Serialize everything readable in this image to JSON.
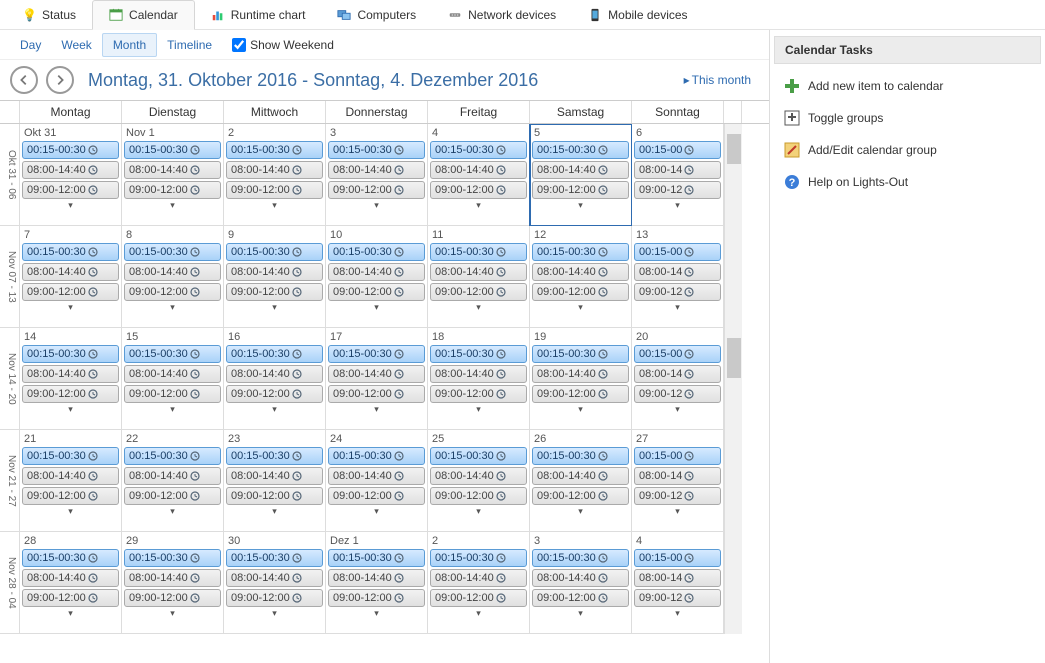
{
  "tabs": {
    "status": "Status",
    "calendar": "Calendar",
    "runtime": "Runtime chart",
    "computers": "Computers",
    "network": "Network devices",
    "mobile": "Mobile devices"
  },
  "view": {
    "day": "Day",
    "week": "Week",
    "month": "Month",
    "timeline": "Timeline",
    "show_weekend": "Show Weekend"
  },
  "header": {
    "range": "Montag, 31. Oktober 2016 - Sonntag, 4. Dezember 2016",
    "this_month": "This month"
  },
  "columns": [
    "",
    "Montag",
    "Dienstag",
    "Mittwoch",
    "Donnerstag",
    "Freitag",
    "Samstag",
    "Sonntag",
    ""
  ],
  "weeks": [
    {
      "label": "Okt 31 - 06",
      "days": [
        {
          "label": "Okt 31",
          "narrow": false,
          "sel": false
        },
        {
          "label": "Nov 1",
          "narrow": false,
          "sel": false
        },
        {
          "label": "2",
          "narrow": false,
          "sel": false
        },
        {
          "label": "3",
          "narrow": false,
          "sel": false
        },
        {
          "label": "4",
          "narrow": false,
          "sel": false
        },
        {
          "label": "5",
          "narrow": false,
          "sel": true
        },
        {
          "label": "6",
          "narrow": true,
          "sel": false
        }
      ]
    },
    {
      "label": "Nov 07 - 13",
      "days": [
        {
          "label": "7",
          "narrow": false
        },
        {
          "label": "8",
          "narrow": false
        },
        {
          "label": "9",
          "narrow": false
        },
        {
          "label": "10",
          "narrow": false
        },
        {
          "label": "11",
          "narrow": false
        },
        {
          "label": "12",
          "narrow": false
        },
        {
          "label": "13",
          "narrow": true
        }
      ]
    },
    {
      "label": "Nov 14 - 20",
      "days": [
        {
          "label": "14",
          "narrow": false
        },
        {
          "label": "15",
          "narrow": false
        },
        {
          "label": "16",
          "narrow": false
        },
        {
          "label": "17",
          "narrow": false
        },
        {
          "label": "18",
          "narrow": false
        },
        {
          "label": "19",
          "narrow": false
        },
        {
          "label": "20",
          "narrow": true
        }
      ]
    },
    {
      "label": "Nov 21 - 27",
      "days": [
        {
          "label": "21",
          "narrow": false
        },
        {
          "label": "22",
          "narrow": false
        },
        {
          "label": "23",
          "narrow": false
        },
        {
          "label": "24",
          "narrow": false
        },
        {
          "label": "25",
          "narrow": false
        },
        {
          "label": "26",
          "narrow": false
        },
        {
          "label": "27",
          "narrow": true
        }
      ]
    },
    {
      "label": "Nov 28 - 04",
      "days": [
        {
          "label": "28",
          "narrow": false
        },
        {
          "label": "29",
          "narrow": false
        },
        {
          "label": "30",
          "narrow": false
        },
        {
          "label": "Dez 1",
          "narrow": false
        },
        {
          "label": "2",
          "narrow": false
        },
        {
          "label": "3",
          "narrow": false
        },
        {
          "label": "4",
          "narrow": true
        }
      ]
    }
  ],
  "events": {
    "wide": [
      {
        "text": "00:15-00:30",
        "cls": "blue"
      },
      {
        "text": "08:00-14:40",
        "cls": "gray"
      },
      {
        "text": "09:00-12:00",
        "cls": "gray"
      }
    ],
    "narrow": [
      {
        "text": "00:15-00",
        "cls": "blue"
      },
      {
        "text": "08:00-14",
        "cls": "gray"
      },
      {
        "text": "09:00-12",
        "cls": "gray"
      }
    ]
  },
  "tasks": {
    "title": "Calendar Tasks",
    "add": "Add new item to calendar",
    "toggle": "Toggle groups",
    "edit": "Add/Edit calendar group",
    "help": "Help on Lights-Out"
  }
}
